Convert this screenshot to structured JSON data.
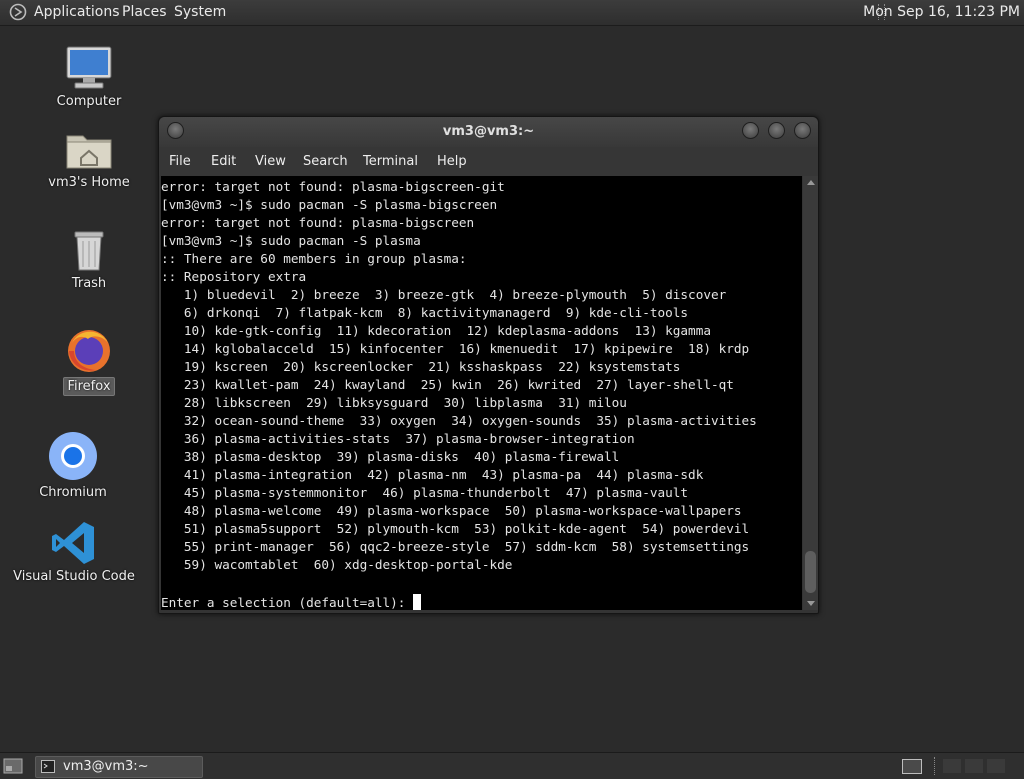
{
  "top_panel": {
    "menus": [
      "Applications",
      "Places",
      "System"
    ],
    "clock": "Mon Sep 16, 11:23 PM"
  },
  "desktop": {
    "icons": [
      {
        "label": "Computer",
        "icon": "computer-icon"
      },
      {
        "label": "vm3's Home",
        "icon": "home-folder-icon"
      },
      {
        "label": "Trash",
        "icon": "trash-icon"
      },
      {
        "label": "Firefox",
        "icon": "firefox-icon"
      },
      {
        "label": "Chromium",
        "icon": "chromium-icon"
      },
      {
        "label": "Visual Studio Code",
        "icon": "vscode-icon"
      }
    ]
  },
  "terminal": {
    "title": "vm3@vm3:~",
    "menu": [
      "File",
      "Edit",
      "View",
      "Search",
      "Terminal",
      "Help"
    ],
    "lines": [
      "error: target not found: plasma-bigscreen-git",
      "[vm3@vm3 ~]$ sudo pacman -S plasma-bigscreen",
      "error: target not found: plasma-bigscreen",
      "[vm3@vm3 ~]$ sudo pacman -S plasma",
      ":: There are 60 members in group plasma:",
      ":: Repository extra",
      "   1) bluedevil  2) breeze  3) breeze-gtk  4) breeze-plymouth  5) discover",
      "   6) drkonqi  7) flatpak-kcm  8) kactivitymanagerd  9) kde-cli-tools",
      "   10) kde-gtk-config  11) kdecoration  12) kdeplasma-addons  13) kgamma",
      "   14) kglobalacceld  15) kinfocenter  16) kmenuedit  17) kpipewire  18) krdp",
      "   19) kscreen  20) kscreenlocker  21) ksshaskpass  22) ksystemstats",
      "   23) kwallet-pam  24) kwayland  25) kwin  26) kwrited  27) layer-shell-qt",
      "   28) libkscreen  29) libksysguard  30) libplasma  31) milou",
      "   32) ocean-sound-theme  33) oxygen  34) oxygen-sounds  35) plasma-activities",
      "   36) plasma-activities-stats  37) plasma-browser-integration",
      "   38) plasma-desktop  39) plasma-disks  40) plasma-firewall",
      "   41) plasma-integration  42) plasma-nm  43) plasma-pa  44) plasma-sdk",
      "   45) plasma-systemmonitor  46) plasma-thunderbolt  47) plasma-vault",
      "   48) plasma-welcome  49) plasma-workspace  50) plasma-workspace-wallpapers",
      "   51) plasma5support  52) plymouth-kcm  53) polkit-kde-agent  54) powerdevil",
      "   55) print-manager  56) qqc2-breeze-style  57) sddm-kcm  58) systemsettings",
      "   59) wacomtablet  60) xdg-desktop-portal-kde",
      ""
    ],
    "prompt": "Enter a selection (default=all): "
  },
  "bottom_panel": {
    "task_label": "vm3@vm3:~"
  }
}
